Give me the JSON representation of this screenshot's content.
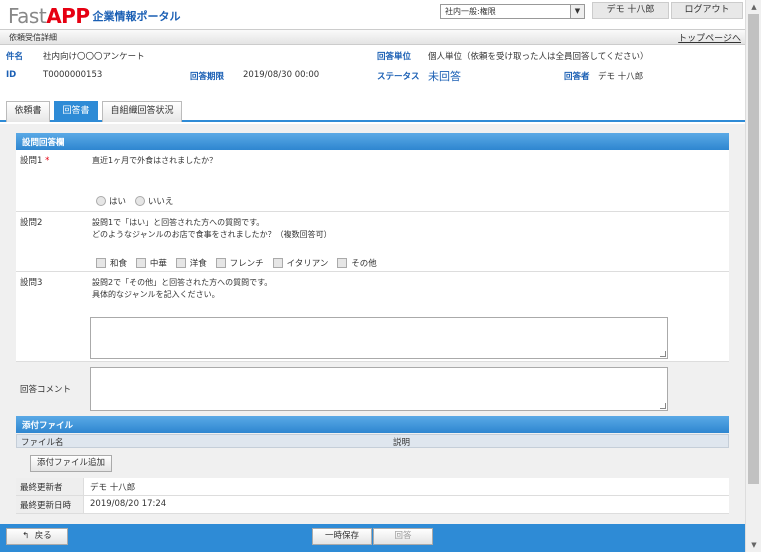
{
  "header": {
    "logo_fast": "Fast",
    "logo_app": "APP",
    "logo_portal": "企業情報ポータル",
    "role_select": "社内一般:権限",
    "user_name": "デモ 十八郎",
    "logout": "ログアウト"
  },
  "titlebar": {
    "title": "依頼受信詳細",
    "top_link": "トップページへ"
  },
  "info": {
    "subject_label": "件名",
    "subject_value": "社内向け〇〇〇アンケート",
    "answer_unit_label": "回答単位",
    "answer_unit_value": "個人単位（依頼を受け取った人は全員回答してください）",
    "id_label": "ID",
    "id_value": "T0000000153",
    "deadline_label": "回答期限",
    "deadline_value": "2019/08/30 00:00",
    "status_label": "ステータス",
    "status_value": "未回答",
    "respondent_label": "回答者",
    "respondent_value": "デモ 十八郎"
  },
  "tabs": [
    {
      "label": "依頼書"
    },
    {
      "label": "回答書"
    },
    {
      "label": "自組織回答状況"
    }
  ],
  "answer_section": {
    "title": "設問回答欄",
    "q1": {
      "label": "設問1",
      "required_mark": "*",
      "text": "直近1ヶ月で外食はされましたか？",
      "options": [
        "はい",
        "いいえ"
      ]
    },
    "q2": {
      "label": "設問2",
      "text_line1": "設問1で「はい」と回答された方への質問です。",
      "text_line2": "どのようなジャンルのお店で食事をされましたか？（複数回答可）",
      "options": [
        "和食",
        "中華",
        "洋食",
        "フレンチ",
        "イタリアン",
        "その他"
      ]
    },
    "q3": {
      "label": "設問3",
      "text_line1": "設問2で「その他」と回答された方への質問です。",
      "text_line2": "具体的なジャンルを記入ください。"
    },
    "comment_label": "回答コメント"
  },
  "attachment_section": {
    "title": "添付ファイル",
    "col_filename": "ファイル名",
    "col_description": "説明",
    "add_button": "添付ファイル追加"
  },
  "meta": {
    "updated_by_label": "最終更新者",
    "updated_by_value": "デモ 十八郎",
    "updated_at_label": "最終更新日時",
    "updated_at_value": "2019/08/20 17:24"
  },
  "footer": {
    "back": "戻る",
    "save_temp": "一時保存",
    "submit": "回答"
  }
}
